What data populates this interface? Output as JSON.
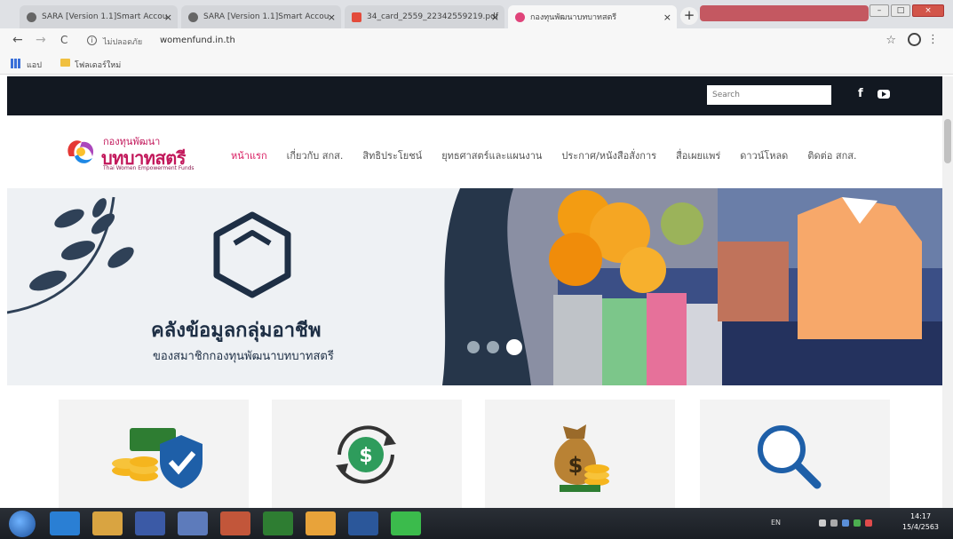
{
  "browser": {
    "tabs": [
      {
        "title": "SARA [Version 1.1]Smart Accou",
        "icon": "chrome-icon"
      },
      {
        "title": "SARA [Version 1.1]Smart Accou",
        "icon": "chrome-icon"
      },
      {
        "title": "34_card_2559_22342559219.pdf",
        "icon": "pdf-icon"
      },
      {
        "title": "กองทุนพัฒนาบทบาทสตรี",
        "icon": "favicon"
      }
    ],
    "tab_close": "×",
    "new_tab": "+",
    "window_controls": {
      "minimize": "–",
      "maximize": "□",
      "close": "×"
    },
    "back": "←",
    "forward": "→",
    "reload": "C",
    "security_label": "ไม่ปลอดภัย",
    "url": "womenfund.in.th",
    "star": "☆",
    "menu": "⋮",
    "bookmarks": {
      "apps_label": "แอป",
      "folder_label": "โฟลเดอร์ใหม่"
    }
  },
  "site": {
    "search_placeholder": "Search",
    "facebook_glyph": "f",
    "logo": {
      "line1": "กองทุนพัฒนา",
      "line2": "บทบาทสตรี",
      "line3": "Thai Women Empowerment Funds"
    },
    "nav": [
      "หน้าแรก",
      "เกี่ยวกับ สกส.",
      "สิทธิประโยชน์",
      "ยุทธศาสตร์และแผนงาน",
      "ประกาศ/หนังสือสั่งการ",
      "สื่อเผยแพร่",
      "ดาวน์โหลด",
      "ติดต่อ สกส."
    ],
    "nav_active_index": 0,
    "banner": {
      "title": "คลังข้อมูลกลุ่มอาชีพ",
      "subtitle": "ของสมาชิกกองทุนพัฒนาบทบาทสตรี",
      "slide_count": 3,
      "active_slide": 3
    },
    "cards": [
      {
        "icon": "coins-shield-icon"
      },
      {
        "icon": "dollar-exchange-icon"
      },
      {
        "icon": "money-bag-icon"
      },
      {
        "icon": "magnifier-icon"
      }
    ]
  },
  "taskbar": {
    "language": "EN",
    "time": "14:17",
    "date": "15/4/2563"
  },
  "colors": {
    "brand_pink": "#d81b60",
    "topbar": "#121821",
    "banner_navy": "#1e2f45"
  }
}
